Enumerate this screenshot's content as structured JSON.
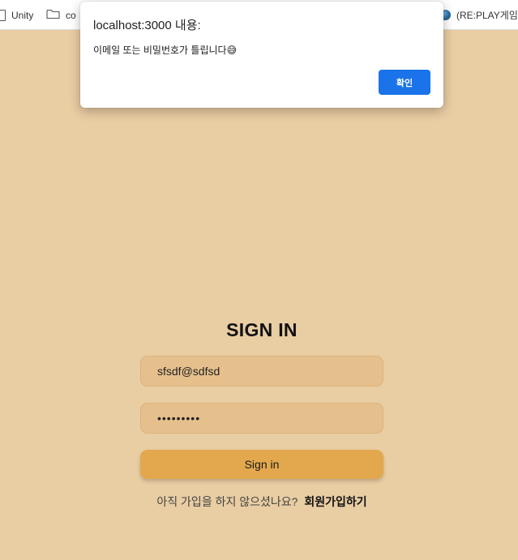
{
  "bookmarks": {
    "items": [
      {
        "label": "Unity",
        "icon": "page-icon"
      },
      {
        "label": "co",
        "icon": "folder-icon"
      },
      {
        "label": "(RE:PLAY게임",
        "icon": "globe-icon"
      }
    ]
  },
  "alert": {
    "title": "localhost:3000 내용:",
    "message": "이메일 또는 비밀번호가 틀립니다😅",
    "ok_label": "확인",
    "ok_color": "#1a73e8"
  },
  "signin": {
    "title": "SIGN IN",
    "email_value": "sfsdf@sdfsd",
    "password_value": "•••••••••",
    "button_label": "Sign in",
    "signup_prompt": "아직 가입을 하지 않으셨나요?",
    "signup_link": "회원가입하기"
  },
  "colors": {
    "background": "#e9cda3",
    "input": "#e6c08c",
    "button": "#e3a84e"
  }
}
